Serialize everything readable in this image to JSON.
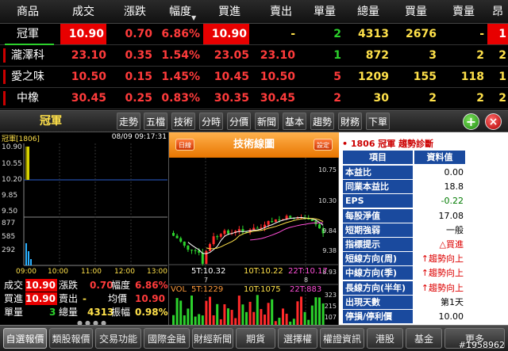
{
  "header": {
    "columns": [
      "商品",
      "成交",
      "漲跌",
      "幅度",
      "買進",
      "賣出",
      "單量",
      "總量",
      "買量",
      "賣量",
      "昂"
    ]
  },
  "rows": [
    {
      "name": "冠軍",
      "price": "10.90",
      "change": "0.70",
      "pct": "6.86%",
      "bid": "10.90",
      "ask": "-",
      "tick_vol": "2",
      "total_vol": "4313",
      "bid_vol": "2676",
      "ask_vol": "-",
      "extra": "1"
    },
    {
      "name": "瀧澤科",
      "price": "23.10",
      "change": "0.35",
      "pct": "1.54%",
      "bid": "23.05",
      "ask": "23.10",
      "tick_vol": "1",
      "total_vol": "872",
      "bid_vol": "3",
      "ask_vol": "2",
      "extra": "2"
    },
    {
      "name": "愛之味",
      "price": "10.50",
      "change": "0.15",
      "pct": "1.45%",
      "bid": "10.45",
      "ask": "10.50",
      "tick_vol": "5",
      "total_vol": "1209",
      "bid_vol": "155",
      "ask_vol": "118",
      "extra": "1"
    },
    {
      "name": "中橡",
      "price": "30.45",
      "change": "0.25",
      "pct": "0.83%",
      "bid": "30.35",
      "ask": "30.45",
      "tick_vol": "2",
      "total_vol": "30",
      "bid_vol": "2",
      "ask_vol": "2",
      "extra": "2"
    }
  ],
  "toolbar": {
    "selected_name": "冠軍",
    "tabs": [
      "走勢",
      "五檔",
      "技術",
      "分時",
      "分價",
      "新聞",
      "基本",
      "趨勢",
      "財務",
      "下單"
    ],
    "add_symbol": "+",
    "close_symbol": "×"
  },
  "intraday": {
    "code": "冠軍[1806]",
    "datetime": "08/09 09:17:31",
    "price_axis": [
      "10.90",
      "10.55",
      "10.20",
      "9.85",
      "9.50"
    ],
    "vol_axis": [
      "877",
      "585",
      "292"
    ],
    "time_axis": [
      "09:00",
      "10:00",
      "11:00",
      "12:00",
      "13:00"
    ],
    "stats": {
      "trade_label": "成交",
      "trade_value": "10.90",
      "change_label": "漲跌",
      "change_value": "0.70",
      "pct_label": "幅度",
      "pct_value": "6.86%",
      "bid_label": "買進",
      "bid_value": "10.90",
      "ask_label": "賣出",
      "ask_value": "-",
      "avg_label": "均價",
      "avg_value": "10.90",
      "unit_label": "單量",
      "unit_value": "3",
      "total_label": "總量",
      "total_value": "4313",
      "amp_label": "振幅",
      "amp_value": "0.98%"
    }
  },
  "technical": {
    "title": "技術線圖",
    "period_button": "日線",
    "settings_button": "設定",
    "price_axis": [
      "10.75",
      "10.30",
      "9.84",
      "9.38",
      "8.93"
    ],
    "ma": {
      "ma5": "5T:10.32",
      "ma10": "10T:10.22",
      "ma22": "22T:10.17"
    },
    "vol": {
      "label": "VOL",
      "v5": "5T:1229",
      "v10": "10T:1075",
      "v22": "22T:883"
    },
    "month_ticks": [
      "7",
      "8"
    ],
    "vol_axis": [
      "323",
      "215",
      "107"
    ],
    "colors": {
      "up": "#ff2a2a",
      "down": "#2cd12c",
      "ma5": "#ffffff",
      "ma10": "#ffe14a",
      "ma22": "#ff4fd8"
    }
  },
  "diagnosis": {
    "title": "• 1806 冠軍 趨勢診斷",
    "headers": [
      "項目",
      "資料值"
    ],
    "items": [
      {
        "k": "本益比",
        "v": "0.00",
        "style": ""
      },
      {
        "k": "同業本益比",
        "v": "18.8",
        "style": ""
      },
      {
        "k": "EPS",
        "v": "-0.22",
        "style": "neg"
      },
      {
        "k": "每股淨值",
        "v": "17.08",
        "style": ""
      },
      {
        "k": "短期強弱",
        "v": "一般",
        "style": ""
      },
      {
        "k": "指標提示",
        "v": "△買進",
        "style": "up"
      },
      {
        "k": "短線方向(周)",
        "v": "↑趨勢向上",
        "style": "up"
      },
      {
        "k": "中線方向(季)",
        "v": "↑趨勢向上",
        "style": "up"
      },
      {
        "k": "長線方向(半年)",
        "v": "↑趨勢向上",
        "style": "up"
      },
      {
        "k": "出現天數",
        "v": "第1天",
        "style": ""
      },
      {
        "k": "停損/停利價",
        "v": "10.00",
        "style": ""
      }
    ]
  },
  "bottom_nav": [
    "自選報價",
    "類股報價",
    "交易功能",
    "國際金融",
    "財經新聞",
    "期貨",
    "選擇權",
    "權證資訊",
    "港股",
    "基金",
    "更多"
  ],
  "watermark": "#1958962"
}
